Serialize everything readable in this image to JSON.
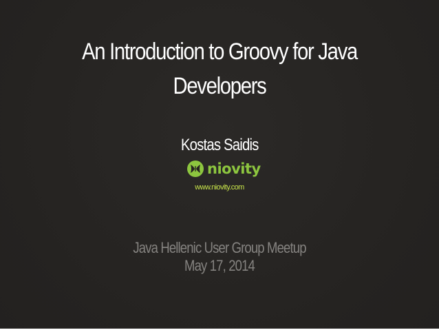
{
  "slide": {
    "title_line1": "An Introduction to Groovy for Java",
    "title_line2": "Developers",
    "author": "Kostas Saidis",
    "company_logo_text": "niovity",
    "company_url": "www.niovity.com",
    "event_name": "Java Hellenic User Group Meetup",
    "event_date": "May 17, 2014"
  },
  "colors": {
    "background": "#262422",
    "title": "#ffffff",
    "logo_green": "#8dc63f",
    "url_green": "#c7e34a",
    "event_gray": "#858380"
  }
}
